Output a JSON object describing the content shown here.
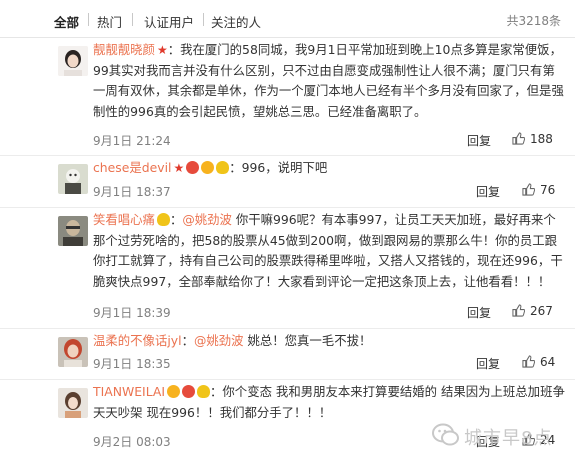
{
  "tabs": [
    {
      "label": "全部"
    },
    {
      "label": "热门"
    },
    {
      "label": "认证用户"
    },
    {
      "label": "关注的人"
    }
  ],
  "total": "共3218条",
  "reply_label": "回复",
  "comments": [
    {
      "user": "靓靓靓晓颜",
      "text": "：我在厦门的58同城，我9月1日平常加班到晚上10点多算是家常便饭，99其实对我而言并没有什么区别，只不过由自愿变成强制性让人很不满；厦门只有第一周有双休，其余都是单休，作为一个厦门本地人已经有半个多月没有回家了，但是强制性的996真的会引起民愤，望姚总三思。已经准备离职了。",
      "time": "9月1日 21:24",
      "likes": "188"
    },
    {
      "user": "chese是devil",
      "text": "：996，说明下吧",
      "time": "9月1日 18:37",
      "likes": "76"
    },
    {
      "user": "笑看唱心痛",
      "mention": "@姚劲波",
      "text": "你干嘛996呢？有本事997，让员工天天加班，最好再来个那个过劳死啥的，把58的股票从45做到200啊，做到跟网易的票那么牛！你的员工跟你打工就算了，持有自己公司的股票跌得稀里哗啦，又搭人又搭钱的，现在还996，干脆爽快点997，全部奉献给你了！大家看到评论一定把这条顶上去，让他看看！！！",
      "time": "9月1日 18:39",
      "likes": "267"
    },
    {
      "user": "温柔的不像话jyl",
      "mention": "@姚劲波",
      "text": "姚总！您真一毛不拔！",
      "time": "9月1日 18:35",
      "likes": "64"
    },
    {
      "user": "TIANWEILAI",
      "text": "：你个变态 我和男朋友本来打算要结婚的 结果因为上班总加班争天天吵架 现在996！！我们都分手了！！！",
      "time": "9月2日 08:03",
      "likes": "24"
    }
  ],
  "watermark": "城市早8点",
  "colors": {
    "username": "#eb7350",
    "meta": "#808080",
    "text": "#333333",
    "divider": "#ececec"
  }
}
